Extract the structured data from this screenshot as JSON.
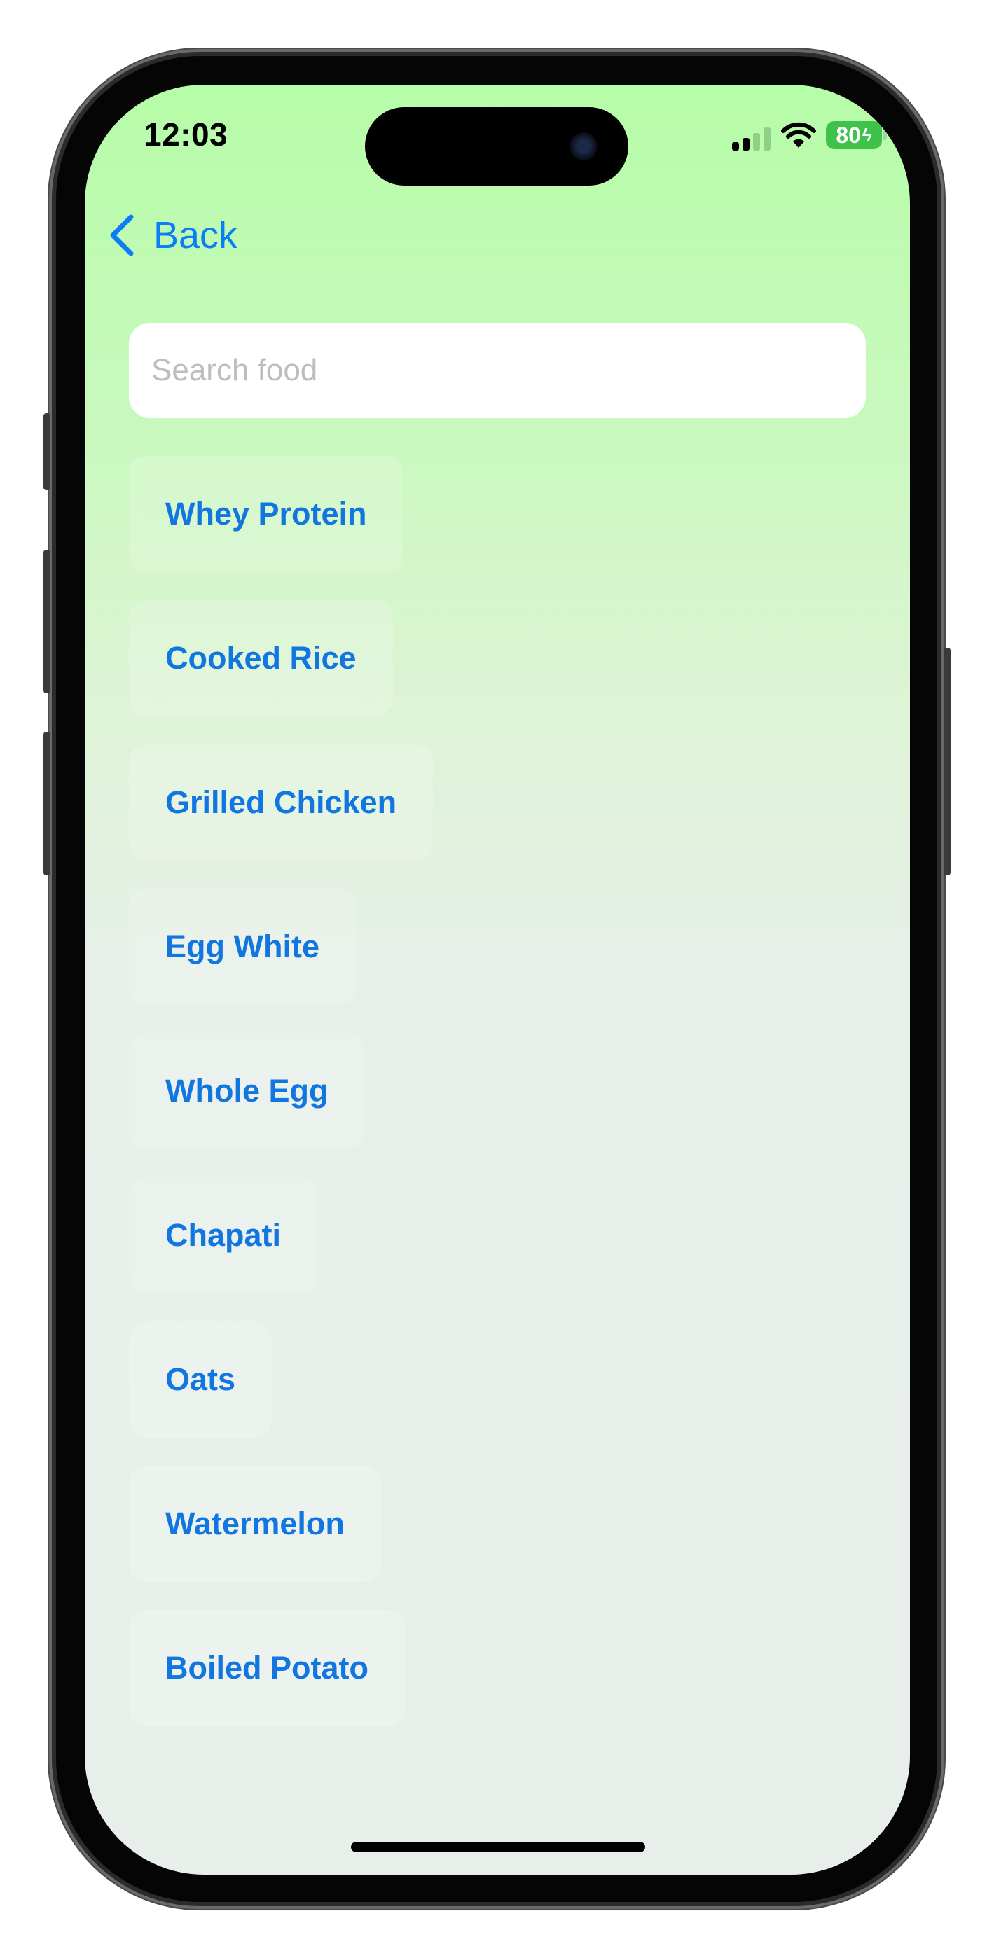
{
  "status_bar": {
    "time": "12:03",
    "battery": "80",
    "battery_color": "#3ec24a"
  },
  "nav": {
    "back_label": "Back",
    "back_icon": "chevron-left-icon",
    "accent": "#0b7ef7"
  },
  "search": {
    "placeholder": "Search food",
    "value": ""
  },
  "foods": [
    "Whey Protein",
    "Cooked Rice",
    "Grilled Chicken",
    "Egg White",
    "Whole Egg",
    "Chapati",
    "Oats",
    "Watermelon",
    "Boiled Potato"
  ]
}
